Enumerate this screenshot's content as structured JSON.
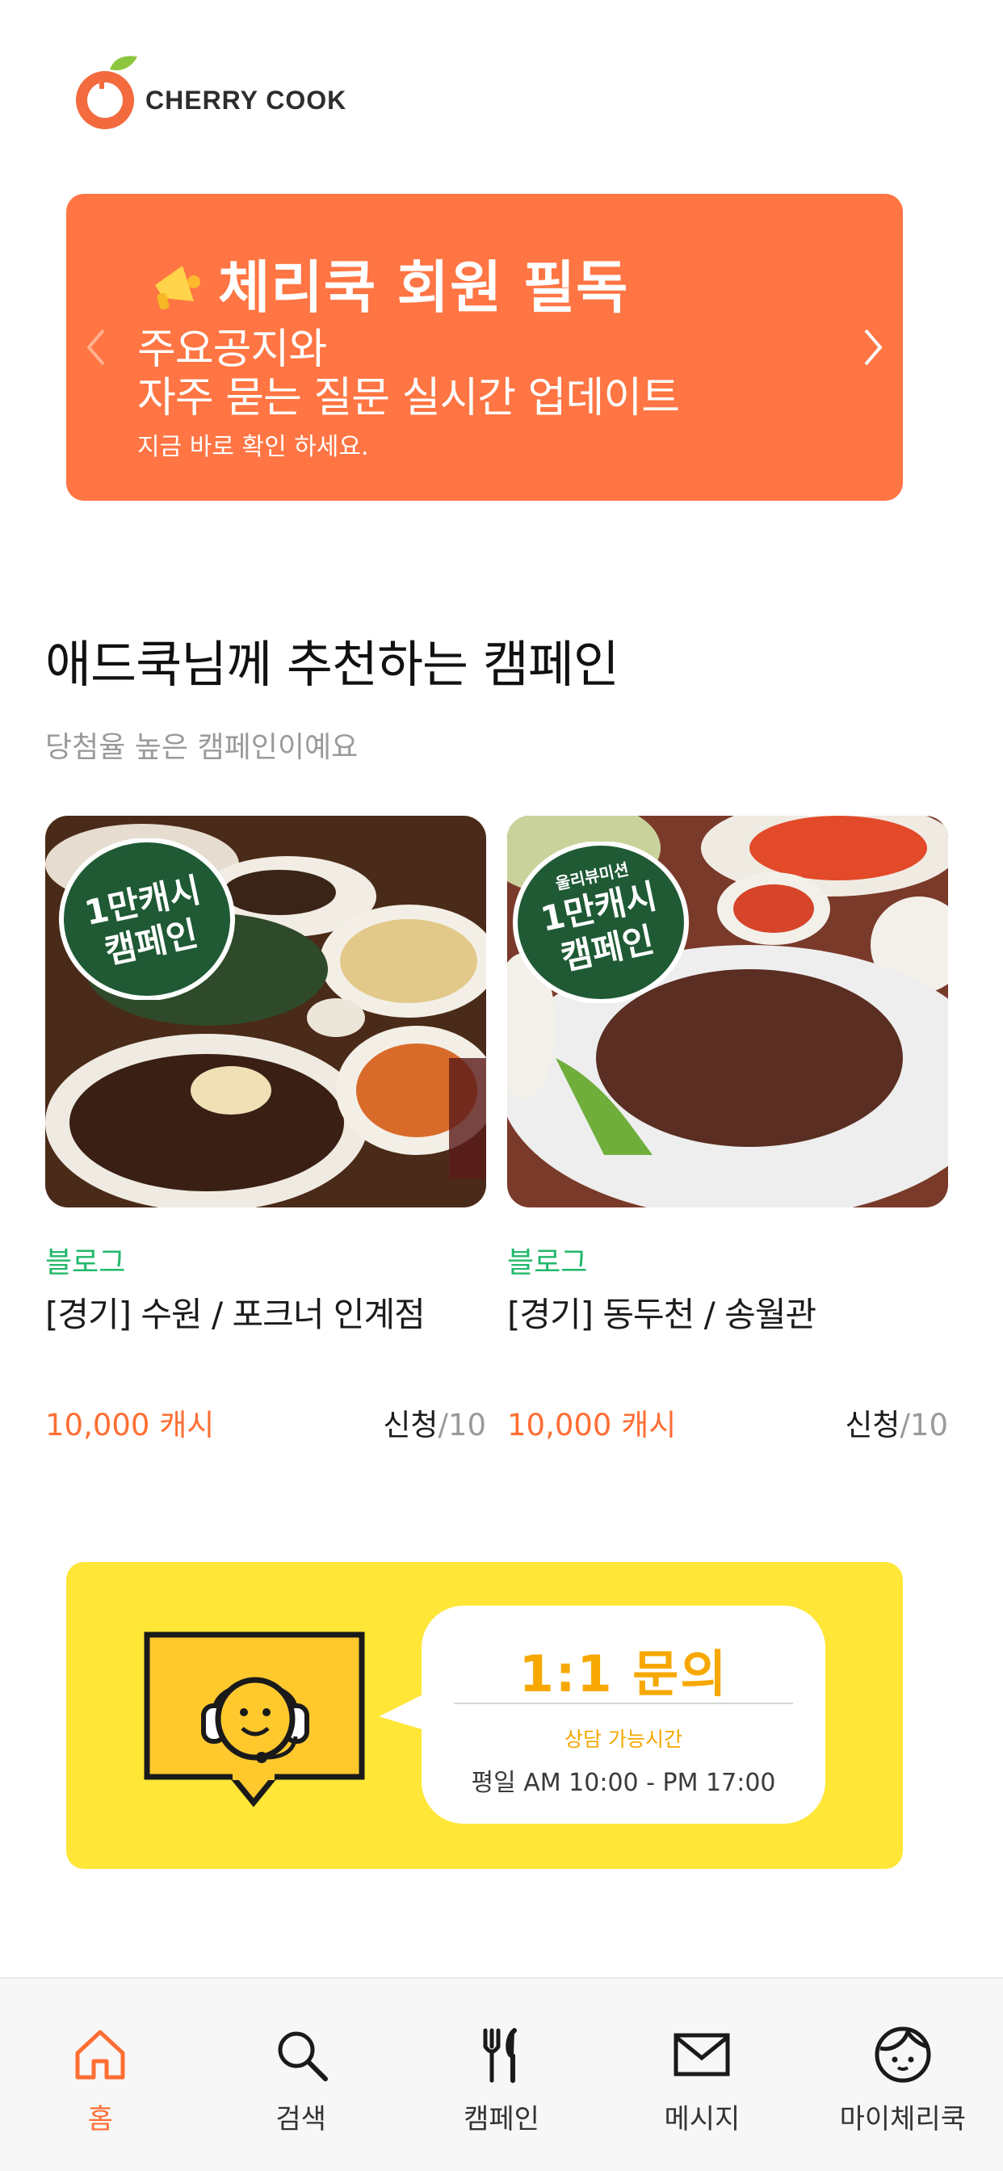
{
  "header": {
    "logo_text": "CHERRY COOK"
  },
  "banner": {
    "title": "체리쿡 회원 필독",
    "line1": "주요공지와",
    "line2": "자주 묻는 질문 실시간 업데이트",
    "sub": "지금 바로 확인 하세요.",
    "color": "#ff7543"
  },
  "section": {
    "title": "애드쿡님께 추천하는 캠페인",
    "subtitle": "당첨율 높은 캠페인이예요"
  },
  "campaigns": [
    {
      "type": "블로그",
      "title": "[경기] 수원 / 포크너 인계점",
      "price": "10,000 캐시",
      "apply_label": "신청",
      "apply_total": "/10",
      "badge_line1": "1만캐시",
      "badge_line2": "캠페인"
    },
    {
      "type": "블로그",
      "title": "[경기] 동두천 / 송월관",
      "price": "10,000 캐시",
      "apply_label": "신청",
      "apply_total": "/10",
      "badge_top": "울리뷰미션",
      "badge_line1": "1만캐시",
      "badge_line2": "캠페인"
    }
  ],
  "inquiry": {
    "title": "1:1 문의",
    "hours_label": "상담 가능시간",
    "hours": "평일 AM 10:00 - PM 17:00",
    "color": "#ffe637"
  },
  "nav": {
    "items": [
      {
        "label": "홈",
        "icon": "home-icon",
        "active": true
      },
      {
        "label": "검색",
        "icon": "search-icon",
        "active": false
      },
      {
        "label": "캠페인",
        "icon": "fork-knife-icon",
        "active": false
      },
      {
        "label": "메시지",
        "icon": "mail-icon",
        "active": false
      },
      {
        "label": "마이체리쿡",
        "icon": "profile-face-icon",
        "active": false
      }
    ],
    "accent": "#ff6e33"
  }
}
